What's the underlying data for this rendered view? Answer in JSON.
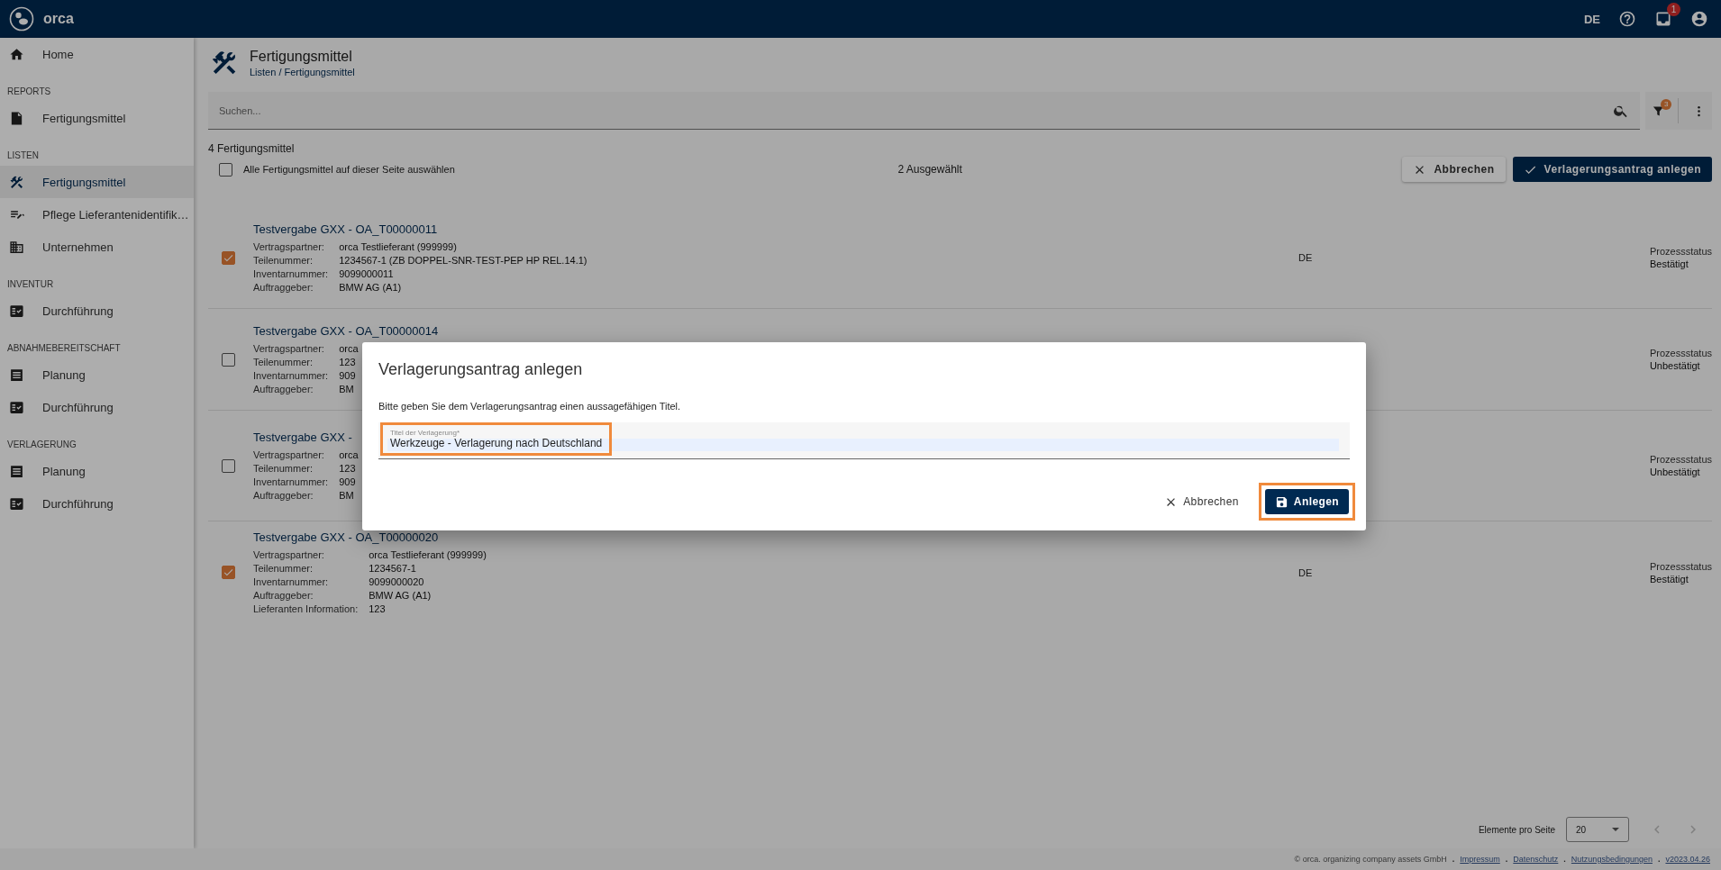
{
  "topbar": {
    "brand": "orca",
    "language": "DE",
    "inbox_badge": "1"
  },
  "sidebar": {
    "sections": [
      {
        "items": [
          {
            "label": "Home",
            "selected": false
          }
        ]
      },
      {
        "heading": "REPORTS",
        "items": [
          {
            "label": "Fertigungsmittel",
            "selected": false
          }
        ]
      },
      {
        "heading": "LISTEN",
        "items": [
          {
            "label": "Fertigungsmittel",
            "selected": true
          },
          {
            "label": "Pflege Lieferantenidentifik…",
            "selected": false
          },
          {
            "label": "Unternehmen",
            "selected": false
          }
        ]
      },
      {
        "heading": "INVENTUR",
        "items": [
          {
            "label": "Durchführung",
            "selected": false
          }
        ]
      },
      {
        "heading": "ABNAHMEBEREITSCHAFT",
        "items": [
          {
            "label": "Planung",
            "selected": false
          },
          {
            "label": "Durchführung",
            "selected": false
          }
        ]
      },
      {
        "heading": "VERLAGERUNG",
        "items": [
          {
            "label": "Planung",
            "selected": false
          },
          {
            "label": "Durchführung",
            "selected": false
          }
        ]
      }
    ]
  },
  "header": {
    "title": "Fertigungsmittel",
    "breadcrumb": "Listen / Fertigungsmittel"
  },
  "search": {
    "placeholder": "Suchen..."
  },
  "filter_badge": "3",
  "list": {
    "count_number": "4",
    "count_label": "Fertigungsmittel",
    "select_all": {
      "label": "Alle Fertigungsmittel auf dieser Seite auswählen",
      "checked": false
    },
    "selected_info": "2 Ausgewählt",
    "buttons": [
      {
        "label": "Abbrechen",
        "kind": "cancel"
      },
      {
        "label": "Verlagerungsantrag anlegen",
        "kind": "primary"
      }
    ],
    "rows": [
      {
        "title": "Testvergabe GXX - OA_T00000011",
        "checked": true,
        "fields": [
          {
            "label": "Vertragspartner:",
            "value": "orca Testlieferant (999999)"
          },
          {
            "label": "Teilenummer:",
            "value": "1234567-1 (ZB DOPPEL-SNR-TEST-PEP HP REL.14.1)"
          },
          {
            "label": "Inventarnummer:",
            "value": "9099000011"
          },
          {
            "label": "Auftraggeber:",
            "value": "BMW AG (A1)"
          }
        ],
        "country": "DE",
        "status_label": "Prozessstatus",
        "status": "Bestätigt"
      },
      {
        "title": "Testvergabe GXX - OA_T00000014",
        "checked": false,
        "fields": [
          {
            "label": "Vertragspartner:",
            "value": "orca"
          },
          {
            "label": "Teilenummer:",
            "value": "123"
          },
          {
            "label": "Inventarnummer:",
            "value": "909"
          },
          {
            "label": "Auftraggeber:",
            "value": "BM"
          }
        ],
        "status_label": "Prozessstatus",
        "status": "Unbestätigt"
      },
      {
        "title": "Testvergabe GXX -",
        "checked": false,
        "fields": [
          {
            "label": "Vertragspartner:",
            "value": "orca"
          },
          {
            "label": "Teilenummer:",
            "value": "123"
          },
          {
            "label": "Inventarnummer:",
            "value": "909"
          },
          {
            "label": "Auftraggeber:",
            "value": "BM"
          }
        ],
        "status_label": "Prozessstatus",
        "status": "Unbestätigt"
      },
      {
        "title": "Testvergabe GXX - OA_T00000020",
        "checked": true,
        "fields": [
          {
            "label": "Vertragspartner:",
            "value": "orca Testlieferant (999999)"
          },
          {
            "label": "Teilenummer:",
            "value": "1234567-1"
          },
          {
            "label": "Inventarnummer:",
            "value": "9099000020"
          },
          {
            "label": "Auftraggeber:",
            "value": "BMW AG (A1)"
          },
          {
            "label": "Lieferanten Information:",
            "value": "123"
          }
        ],
        "country": "DE",
        "status_label": "Prozessstatus",
        "status": "Bestätigt"
      }
    ]
  },
  "paginator": {
    "label": "Elemente pro Seite",
    "page_size": "20"
  },
  "footer": {
    "copyright": "© orca. organizing company assets GmbH",
    "separator": ".",
    "links": [
      "Impressum",
      "Datenschutz",
      "Nutzungsbedingungen",
      "v2023.04.26"
    ]
  },
  "dialog": {
    "title": "Verlagerungsantrag anlegen",
    "text": "Bitte geben Sie dem Verlagerungsantrag einen aussagefähigen Titel.",
    "field": {
      "label": "Titel der Verlagerung*",
      "value": "Werkzeuge - Verlagerung nach Deutschland",
      "highlighted": true
    },
    "buttons": [
      {
        "label": "Abbrechen",
        "kind": "cancel",
        "highlighted": false
      },
      {
        "label": "Anlegen",
        "kind": "primary",
        "highlighted": true
      }
    ]
  }
}
